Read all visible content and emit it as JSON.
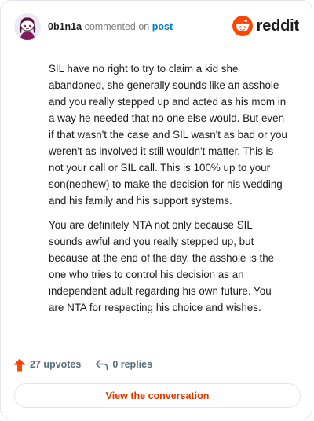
{
  "header": {
    "username": "0b1n1a",
    "action_text": "commented on",
    "post_link": "post",
    "brand": "reddit"
  },
  "comment": {
    "paragraphs": [
      "SIL have no right to try to claim a kid she abandoned, she generally sounds like an asshole and you really stepped up and acted as his mom in a way he needed that no one else would. But even if that wasn't the case and SIL wasn't as bad or you weren't as involved it still wouldn't matter. This is not your call or SIL call. This is 100% up to your son(nephew) to make the decision for his wedding and his family and his support systems.",
      "You are definitely NTA not only because SIL sounds awful and you really stepped up, but because at the end of the day, the asshole is the one who tries to control his decision as an independent adult regarding his own future. You are NTA for respecting his choice and wishes."
    ]
  },
  "actions": {
    "upvotes_label": "27 upvotes",
    "replies_label": "0 replies"
  },
  "footer": {
    "view_button_label": "View the conversation"
  },
  "colors": {
    "brand_orange": "#ff4500",
    "link_blue": "#0079d3",
    "button_text": "#d93a00",
    "muted": "#576f76"
  },
  "icons": {
    "avatar": "snoo-avatar",
    "brand": "reddit-snoo-icon",
    "upvote": "upvote-arrow-icon",
    "reply": "reply-arrow-icon"
  }
}
